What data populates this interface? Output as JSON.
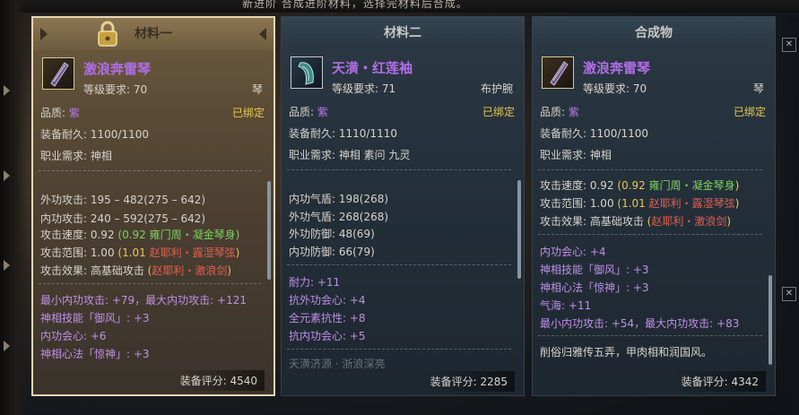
{
  "top_banner": "新进阶    合成进阶材料，选择完材料后合成。",
  "panels": [
    {
      "header": "材料一",
      "item_name": "激浪奔雷琴",
      "level": "等级要求: 70",
      "category": "琴",
      "quality_label": "品质: ",
      "quality_value": "紫",
      "bound": "已绑定",
      "durability": "装备耐久: 1100/1100",
      "class_req": "职业需求: 神相",
      "stats": [
        {
          "label": "外功攻击: 195 – 482(275 – 642)"
        },
        {
          "label": "内功攻击: 240 – 592(275 – 642)"
        },
        {
          "label": "攻击速度: 0.92",
          "extra_a": " (0.92 ",
          "extra_b": "雍门周・凝金琴身",
          "extra_c": ")"
        },
        {
          "label": "攻击范围: 1.00",
          "extra_a": " (1.01 ",
          "extra_b": "赵耶利・露湿琴弦",
          "extra_c": ")"
        },
        {
          "label": "攻击效果: 高基础攻击",
          "extra_a": " (",
          "extra_b": "赵耶利・激浪剑",
          "extra_c": ")"
        }
      ],
      "bonuses": [
        "最小内功攻击: +79，最大内功攻击: +121",
        "神相技能「御风」: +3",
        "内功会心: +6",
        "神相心法「惊神」: +3"
      ],
      "score": "装备评分: 4540"
    },
    {
      "header": "材料二",
      "item_name": "天潢・红莲袖",
      "level": "等级要求: 71",
      "category": "布护腕",
      "quality_label": "品质: ",
      "quality_value": "紫",
      "bound": "已绑定",
      "durability": "装备耐久: 1110/1110",
      "class_req": "职业需求: 神相 素问 九灵",
      "stats": [
        "内功气盾: 198(268)",
        "外功气盾: 268(268)",
        "外功防御: 48(69)",
        "内功防御: 66(79)"
      ],
      "bonuses": [
        "耐力: +11",
        "抗外功会心: +4",
        "全元素抗性: +8",
        "抗内功会心: +5"
      ],
      "faded_text": "天潢济源 · 浙浪深亮",
      "score": "装备评分: 2285"
    },
    {
      "header": "合成物",
      "item_name": "激浪奔雷琴",
      "level": "等级要求: 70",
      "category": "琴",
      "quality_label": "品质: ",
      "quality_value": "紫",
      "bound": "已绑定",
      "durability": "装备耐久: 1100/1100",
      "class_req": "职业需求: 神相",
      "stats": [
        {
          "label": "攻击速度: 0.92",
          "extra_a": " (0.92 ",
          "extra_b": "雍门周・凝金琴身",
          "extra_c": ")"
        },
        {
          "label": "攻击范围: 1.00",
          "extra_a": " (1.01 ",
          "extra_b": "赵耶利・露湿琴弦",
          "extra_c": ")"
        },
        {
          "label": "攻击效果: 高基础攻击",
          "extra_a": " (",
          "extra_b": "赵耶利・激浪剑",
          "extra_c": ")"
        }
      ],
      "bonuses": [
        "内功会心: +4",
        "神相技能「御风」: +3",
        "神相心法「惊神」: +3",
        "气海: +11",
        "最小内功攻击: +54，最大内功攻击: +83"
      ],
      "flavor": "削俗归雅传五弄，甲肉相和润国风。",
      "score": "装备评分: 4342"
    }
  ],
  "colors": {
    "accent_purple": "#b06ee6",
    "bound_yellow": "#e8c850",
    "green": "#7cd060",
    "red": "#e06050"
  }
}
